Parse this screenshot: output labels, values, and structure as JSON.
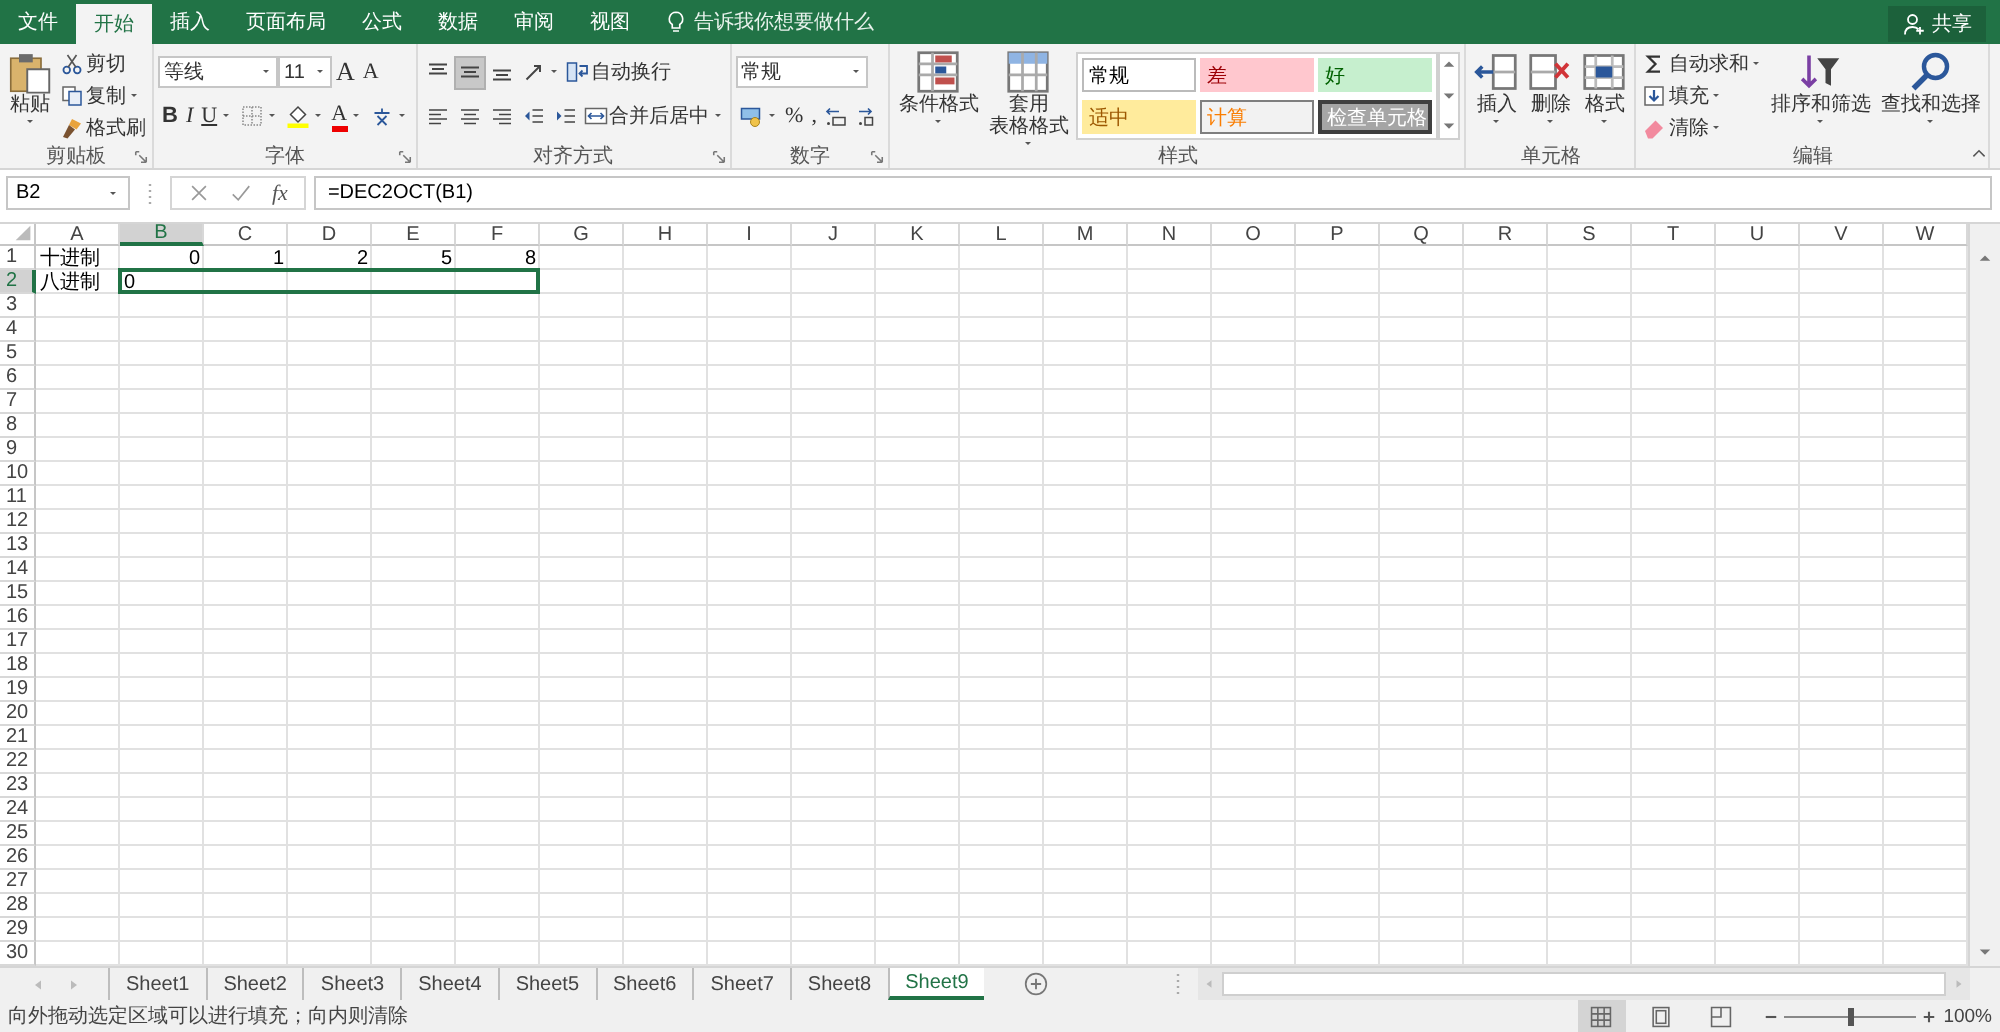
{
  "menu_tabs": [
    {
      "label": "文件",
      "selected": false
    },
    {
      "label": "开始",
      "selected": true
    },
    {
      "label": "插入",
      "selected": false
    },
    {
      "label": "页面布局",
      "selected": false
    },
    {
      "label": "公式",
      "selected": false
    },
    {
      "label": "数据",
      "selected": false
    },
    {
      "label": "审阅",
      "selected": false
    },
    {
      "label": "视图",
      "selected": false
    }
  ],
  "tell_me": "告诉我你想要做什么",
  "share_button": "共享",
  "ribbon_groups": [
    {
      "label": "剪贴板",
      "launcher": true,
      "stacks": [
        [
          {
            "kind": "large",
            "label_lines": [
              "粘贴"
            ],
            "dropdown": true
          }
        ],
        [
          {
            "kind": "small",
            "label": "剪切",
            "dropdown": false
          },
          {
            "kind": "small",
            "label": "复制",
            "dropdown": true
          },
          {
            "kind": "small",
            "label": "格式刷",
            "dropdown": false
          }
        ]
      ]
    },
    {
      "label": "字体",
      "launcher": true,
      "tiers": [
        [
          {
            "kind": "combo",
            "value": "等线"
          },
          {
            "kind": "combo",
            "value": "11"
          },
          {
            "kind": "glyph",
            "label": "A",
            "dropdown": false
          },
          {
            "kind": "glyph",
            "label": "A",
            "dropdown": false
          }
        ],
        [
          {
            "kind": "glyph",
            "label": "B",
            "dropdown": false
          },
          {
            "kind": "glyph",
            "label": "I",
            "dropdown": false
          },
          {
            "kind": "glyph",
            "label": "U",
            "dropdown": true
          },
          {
            "kind": "icon",
            "dropdown": true
          },
          {
            "kind": "icon",
            "dropdown": true
          },
          {
            "kind": "glyph",
            "label": "A",
            "dropdown": true
          },
          {
            "kind": "icon",
            "dropdown": true
          }
        ]
      ]
    },
    {
      "label": "对齐方式",
      "launcher": true,
      "tiers": [
        [
          {
            "kind": "icon",
            "dropdown": false,
            "selected": false
          },
          {
            "kind": "icon",
            "dropdown": false,
            "selected": true
          },
          {
            "kind": "icon",
            "dropdown": false,
            "selected": false
          },
          {
            "kind": "icon",
            "dropdown": true
          },
          {
            "kind": "small",
            "label": "自动换行",
            "dropdown": false
          }
        ],
        [
          {
            "kind": "icon",
            "dropdown": false,
            "selected": false
          },
          {
            "kind": "icon",
            "dropdown": false,
            "selected": false
          },
          {
            "kind": "icon",
            "dropdown": false,
            "selected": false
          },
          {
            "kind": "icon",
            "dropdown": false
          },
          {
            "kind": "icon",
            "dropdown": false
          },
          {
            "kind": "small",
            "label": "合并后居中",
            "dropdown": true
          }
        ]
      ]
    },
    {
      "label": "数字",
      "launcher": true,
      "tiers": [
        [
          {
            "kind": "combo",
            "value": "常规"
          }
        ],
        [
          {
            "kind": "icon",
            "dropdown": true
          },
          {
            "kind": "glyph",
            "label": "%",
            "dropdown": false
          },
          {
            "kind": "glyph",
            "label": ",",
            "dropdown": false
          },
          {
            "kind": "icon",
            "dropdown": false
          },
          {
            "kind": "icon",
            "dropdown": false
          }
        ]
      ]
    },
    {
      "label": "样式",
      "launcher": false,
      "stacks": [
        [
          {
            "kind": "large",
            "label_lines": [
              "条件格式"
            ],
            "dropdown": true
          }
        ],
        [
          {
            "kind": "large",
            "label_lines": [
              "套用",
              "表格格式"
            ],
            "dropdown": true
          }
        ],
        [
          {
            "kind": "gallery",
            "styles": [
              {
                "label": "常规",
                "color": "#ffffff",
                "kind": "normal"
              },
              {
                "label": "差",
                "color": "#ffc7ce",
                "kind": "bad"
              },
              {
                "label": "好",
                "color": "#c6efce",
                "kind": "good"
              },
              {
                "label": "适中",
                "color": "#ffeb9c",
                "kind": "neutral"
              },
              {
                "label": "计算",
                "color": "#f2f2f2",
                "kind": "calculation"
              },
              {
                "label": "检查单元格",
                "color": "#a5a5a5",
                "kind": "check"
              }
            ]
          }
        ]
      ]
    },
    {
      "label": "单元格",
      "launcher": false,
      "stacks": [
        [
          {
            "kind": "large",
            "label_lines": [
              "插入"
            ],
            "dropdown": true
          }
        ],
        [
          {
            "kind": "large",
            "label_lines": [
              "删除"
            ],
            "dropdown": true
          }
        ],
        [
          {
            "kind": "large",
            "label_lines": [
              "格式"
            ],
            "dropdown": true
          }
        ]
      ]
    },
    {
      "label": "编辑",
      "launcher": false,
      "stacks": [
        [
          {
            "kind": "small",
            "label": "自动求和",
            "dropdown": true
          },
          {
            "kind": "small",
            "label": "填充",
            "dropdown": true
          },
          {
            "kind": "small",
            "label": "清除",
            "dropdown": true
          }
        ],
        [
          {
            "kind": "large",
            "label_lines": [
              "排序和筛选"
            ],
            "dropdown": true
          }
        ],
        [
          {
            "kind": "large",
            "label_lines": [
              "查找和选择"
            ],
            "dropdown": true
          }
        ]
      ]
    }
  ],
  "formula_bar": {
    "name_box": "B2",
    "function_button": "fx",
    "formula": "=DEC2OCT(B1)"
  },
  "grid": {
    "columns": [
      {
        "label": "A",
        "selected": false
      },
      {
        "label": "B",
        "selected": true
      },
      {
        "label": "C",
        "selected": false
      },
      {
        "label": "D",
        "selected": false
      },
      {
        "label": "E",
        "selected": false
      },
      {
        "label": "F",
        "selected": false
      },
      {
        "label": "G",
        "selected": false
      },
      {
        "label": "H",
        "selected": false
      },
      {
        "label": "I",
        "selected": false
      },
      {
        "label": "J",
        "selected": false
      },
      {
        "label": "K",
        "selected": false
      },
      {
        "label": "L",
        "selected": false
      },
      {
        "label": "M",
        "selected": false
      },
      {
        "label": "N",
        "selected": false
      },
      {
        "label": "O",
        "selected": false
      },
      {
        "label": "P",
        "selected": false
      },
      {
        "label": "Q",
        "selected": false
      },
      {
        "label": "R",
        "selected": false
      },
      {
        "label": "S",
        "selected": false
      },
      {
        "label": "T",
        "selected": false
      },
      {
        "label": "U",
        "selected": false
      },
      {
        "label": "V",
        "selected": false
      },
      {
        "label": "W",
        "selected": false
      }
    ],
    "rows": [
      {
        "label": "1",
        "selected": false,
        "cells": [
          {
            "text": "十进制",
            "kind": "text",
            "selected": false
          },
          {
            "text": "0",
            "kind": "number",
            "selected": false
          },
          {
            "text": "1",
            "kind": "number",
            "selected": false
          },
          {
            "text": "2",
            "kind": "number",
            "selected": false
          },
          {
            "text": "5",
            "kind": "number",
            "selected": false
          },
          {
            "text": "8",
            "kind": "number",
            "selected": false
          }
        ]
      },
      {
        "label": "2",
        "selected": true,
        "cells": [
          {
            "text": "八进制",
            "kind": "text",
            "selected": false
          },
          {
            "text": "0",
            "kind": "text",
            "selected": true
          },
          {
            "kind": "empty",
            "selected": true
          },
          {
            "kind": "empty",
            "selected": true
          },
          {
            "kind": "empty",
            "selected": true
          },
          {
            "kind": "empty",
            "selected": true
          }
        ]
      },
      {
        "label": "3",
        "selected": false
      },
      {
        "label": "4",
        "selected": false
      },
      {
        "label": "5",
        "selected": false
      },
      {
        "label": "6",
        "selected": false
      },
      {
        "label": "7",
        "selected": false
      },
      {
        "label": "8",
        "selected": false
      },
      {
        "label": "9",
        "selected": false
      },
      {
        "label": "10",
        "selected": false
      },
      {
        "label": "11",
        "selected": false
      },
      {
        "label": "12",
        "selected": false
      },
      {
        "label": "13",
        "selected": false
      },
      {
        "label": "14",
        "selected": false
      },
      {
        "label": "15",
        "selected": false
      },
      {
        "label": "16",
        "selected": false
      },
      {
        "label": "17",
        "selected": false
      },
      {
        "label": "18",
        "selected": false
      },
      {
        "label": "19",
        "selected": false
      },
      {
        "label": "20",
        "selected": false
      },
      {
        "label": "21",
        "selected": false
      },
      {
        "label": "22",
        "selected": false
      },
      {
        "label": "23",
        "selected": false
      },
      {
        "label": "24",
        "selected": false
      },
      {
        "label": "25",
        "selected": false
      },
      {
        "label": "26",
        "selected": false
      },
      {
        "label": "27",
        "selected": false
      },
      {
        "label": "28",
        "selected": false
      },
      {
        "label": "29",
        "selected": false
      },
      {
        "label": "30",
        "selected": false
      }
    ]
  },
  "sheet_tabs": [
    {
      "label": "Sheet1",
      "selected": false
    },
    {
      "label": "Sheet2",
      "selected": false
    },
    {
      "label": "Sheet3",
      "selected": false
    },
    {
      "label": "Sheet4",
      "selected": false
    },
    {
      "label": "Sheet5",
      "selected": false
    },
    {
      "label": "Sheet6",
      "selected": false
    },
    {
      "label": "Sheet7",
      "selected": false
    },
    {
      "label": "Sheet8",
      "selected": false
    },
    {
      "label": "Sheet9",
      "selected": true
    }
  ],
  "status_bar": {
    "message": "向外拖动选定区域可以进行填充；向内则清除",
    "views": [
      {
        "selected": true
      },
      {
        "selected": false
      },
      {
        "selected": false
      }
    ],
    "zoom": {
      "level": 0.5,
      "label": "100%"
    }
  }
}
